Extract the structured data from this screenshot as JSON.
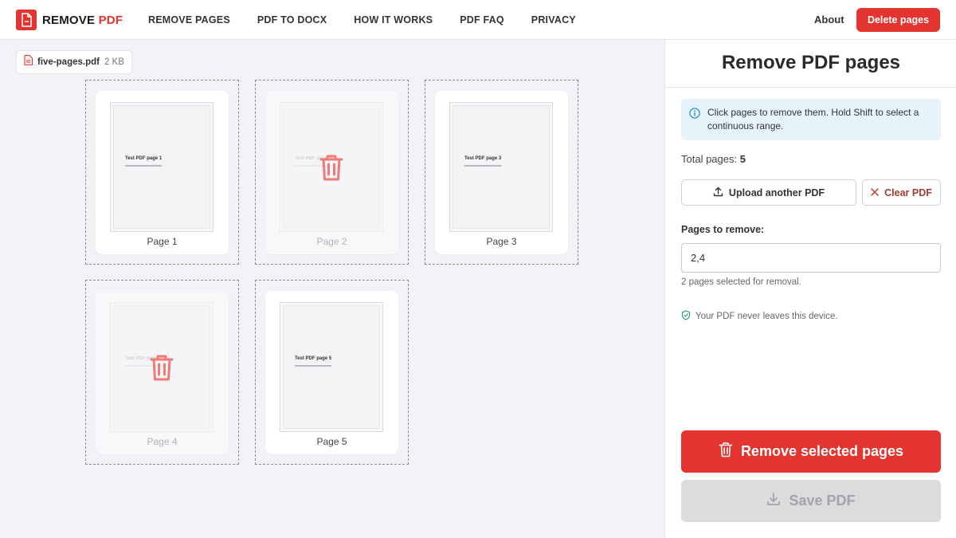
{
  "brand": {
    "name_part1": "REMOVE",
    "name_part2": "PDF",
    "logo_icon": "document-icon",
    "accent_color": "#e3342f"
  },
  "nav": {
    "items": [
      "REMOVE PAGES",
      "PDF TO DOCX",
      "HOW IT WORKS",
      "PDF FAQ",
      "PRIVACY"
    ]
  },
  "header": {
    "about_label": "About",
    "delete_button_label": "Delete pages"
  },
  "file": {
    "name": "five-pages.pdf",
    "size": "2 KB",
    "icon": "pdf-file-icon"
  },
  "pages": [
    {
      "label": "Page 1",
      "title": "Test PDF page 1",
      "selected_for_removal": false
    },
    {
      "label": "Page 2",
      "title": "Test PDF page 2",
      "selected_for_removal": true
    },
    {
      "label": "Page 3",
      "title": "Test PDF page 3",
      "selected_for_removal": false
    },
    {
      "label": "Page 4",
      "title": "Test PDF page 4",
      "selected_for_removal": true
    },
    {
      "label": "Page 5",
      "title": "Test PDF page 5",
      "selected_for_removal": false
    }
  ],
  "panel": {
    "title": "Remove PDF pages",
    "info_text": "Click pages to remove them. Hold Shift to select a continuous range.",
    "total_label": "Total pages:",
    "total_value": "5",
    "upload_label": "Upload another PDF",
    "clear_label": "Clear PDF",
    "pages_to_remove_label": "Pages to remove:",
    "pages_to_remove_value": "2,4",
    "selected_note": "2 pages selected for removal.",
    "privacy_note": "Your PDF never leaves this device.",
    "remove_button_label": "Remove selected pages",
    "save_button_label": "Save PDF",
    "save_disabled": true
  }
}
